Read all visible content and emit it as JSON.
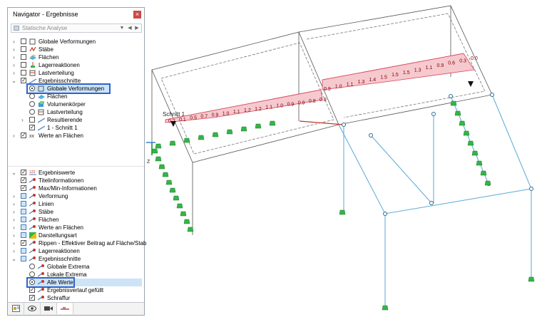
{
  "navigator": {
    "title": "Navigator - Ergebnisse",
    "close_label": "×",
    "analysis_select": "Statische Analyse",
    "tree_top": [
      {
        "label": "Globale Verformungen",
        "checked": false
      },
      {
        "label": "Stäbe",
        "checked": false
      },
      {
        "label": "Flächen",
        "checked": false
      },
      {
        "label": "Lagerreaktionen",
        "checked": false
      },
      {
        "label": "Lastverteilung",
        "checked": false
      },
      {
        "label": "Ergebnisschnitte",
        "checked": true
      },
      {
        "label": "Globale Verformungen",
        "selected": true
      },
      {
        "label": "Flächen"
      },
      {
        "label": "Volumenkörper"
      },
      {
        "label": "Lastverteilung"
      },
      {
        "label": "Resultierende",
        "checked": false
      },
      {
        "label": "1 - Schnitt 1",
        "checked": true
      },
      {
        "label": "Werte an Flächen",
        "checked": true
      }
    ],
    "tree_bottom": [
      {
        "label": "Ergebniswerte",
        "checked": true
      },
      {
        "label": "Titelinformationen",
        "checked": true
      },
      {
        "label": "Max/Min-Informationen",
        "checked": true
      },
      {
        "label": "Verformung",
        "checked": false
      },
      {
        "label": "Linien",
        "checked": false
      },
      {
        "label": "Stäbe",
        "checked": false
      },
      {
        "label": "Flächen",
        "checked": false
      },
      {
        "label": "Werte an Flächen",
        "checked": false
      },
      {
        "label": "Darstellungsart",
        "checked": false
      },
      {
        "label": "Rippen - Effektiver Beitrag auf Fläche/Stab",
        "checked": true
      },
      {
        "label": "Lagerreaktionen",
        "checked": false
      },
      {
        "label": "Ergebnisschnitte",
        "checked": false
      },
      {
        "label": "Globale Extrema"
      },
      {
        "label": "Lokale Extrema"
      },
      {
        "label": "Alle Werte",
        "selected": true
      },
      {
        "label": "Ergebnisverlauf gefüllt",
        "checked": true
      },
      {
        "label": "Schraffur",
        "checked": true
      }
    ],
    "tabs": [
      "data-tab-icon",
      "eye-icon",
      "camera-icon",
      "result-lines-icon"
    ]
  },
  "model_view": {
    "section_label": "Schnitt 1",
    "axis_label": "Z",
    "left_values": [
      "0.2",
      "0.1",
      "0.5",
      "0.7",
      "0.9",
      "1.0",
      "1.1",
      "1.2",
      "1.2",
      "1.1",
      "1.0",
      "0.9",
      "0.9",
      "0.8",
      "0.8"
    ],
    "right_values": [
      "0.9",
      "1.0",
      "1.1",
      "1.3",
      "1.4",
      "1.5",
      "1.5",
      "1.5",
      "1.3",
      "1.1",
      "0.9",
      "0.6",
      "0.3",
      "0.0"
    ],
    "colors": {
      "diagram_fill": "#f6c9cf",
      "diagram_line": "#d8485a",
      "support": "#35b449",
      "frame": "#58a9d6",
      "selection": "#2f64c8"
    }
  }
}
